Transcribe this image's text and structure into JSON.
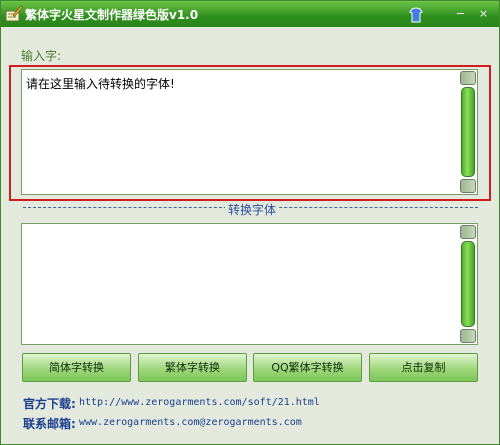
{
  "window": {
    "title": "繁体字火星文制作器绿色版v1.0",
    "accent_color": "#2f8f1d"
  },
  "input": {
    "label": "输入字:",
    "value": "请在这里输入待转换的字体!"
  },
  "output": {
    "divider_label": "转换字体",
    "value": ""
  },
  "buttons": {
    "simplified": "简体字转换",
    "traditional": "繁体字转换",
    "qq_traditional": "QQ繁体字转换",
    "copy": "点击复制"
  },
  "footer": {
    "download_label": "官方下载:",
    "download_url": "http://www.zerogarments.com/soft/21.html",
    "email_label": "联系邮箱:",
    "email_value": "www.zerogarments.com@zerogarments.com"
  },
  "titlebar_buttons": {
    "minimize": "−",
    "close": "×"
  }
}
